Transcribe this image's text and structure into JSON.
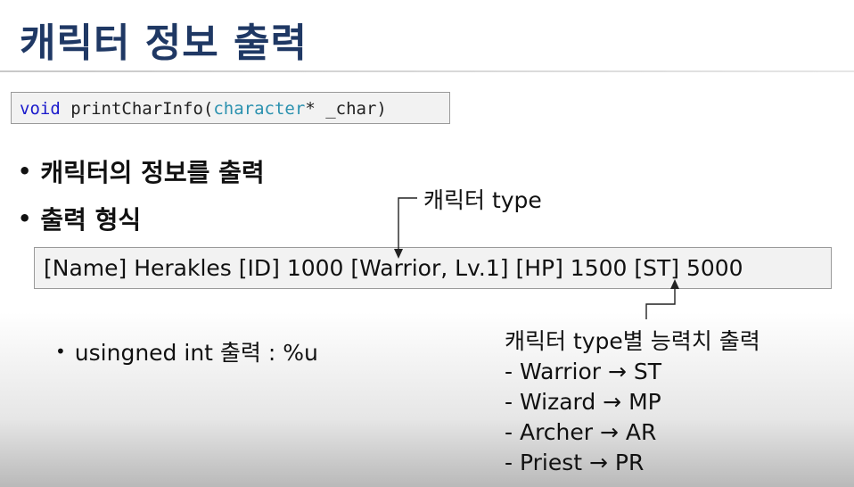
{
  "title": "캐릭터 정보 출력",
  "code": {
    "keyword": "void",
    "func": " printCharInfo(",
    "type": "character",
    "rest": "* _char)"
  },
  "bullets": [
    "캐릭터의 정보를 출력",
    "출력 형식"
  ],
  "annotation_type": "캐릭터 type",
  "output_example": "[Name] Herakles [ID] 1000 [Warrior, Lv.1] [HP] 1500 [ST] 5000",
  "sub_bullet": "usingned int 출력 : %u",
  "type_stats": {
    "heading": "캐릭터 type별 능력치 출력",
    "items": [
      "- Warrior → ST",
      "- Wizard → MP",
      "- Archer → AR",
      "- Priest → PR"
    ]
  }
}
